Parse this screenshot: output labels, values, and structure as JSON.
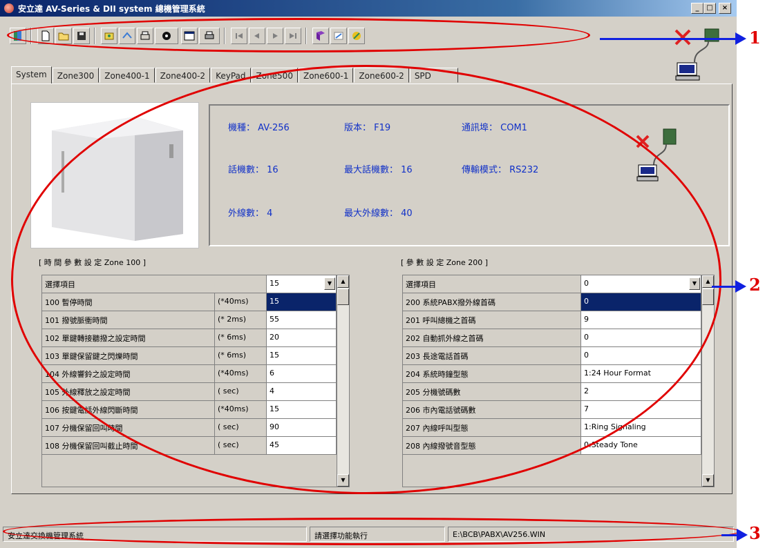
{
  "window": {
    "title": "安立達 AV-Series & DII system 總機管理系統",
    "min_label": "_",
    "max_label": "□",
    "close_label": "×"
  },
  "toolbar": {
    "icons": [
      "exit-icon",
      "new-file-icon",
      "open-folder-icon",
      "save-icon",
      "connect-icon",
      "transfer-icon",
      "print-setup-icon",
      "view-icon",
      "layout-icon",
      "print-icon",
      "first-record-icon",
      "prev-record-icon",
      "next-record-icon",
      "last-record-icon",
      "book-icon",
      "settings-icon",
      "wizard-icon"
    ]
  },
  "tabs": [
    "System",
    "Zone300",
    "Zone400-1",
    "Zone400-2",
    "KeyPad",
    "Zone500",
    "Zone600-1",
    "Zone600-2",
    "SPD"
  ],
  "info": {
    "model": "機種： AV-256",
    "version": "版本： F19",
    "comport": "通訊埠： COM1",
    "extensions": "話機數： 16",
    "max_extensions": "最大話機數： 16",
    "transfer_mode": "傳輸模式： RS232",
    "lines": "外線數： 4",
    "max_lines": "最大外線數： 40"
  },
  "left_section": {
    "title": "[  時 間 參 數 設 定   Zone 100 ]",
    "select_label": "選擇項目",
    "select_value": "15",
    "rows": [
      {
        "label": "100 暫停時間",
        "unit": "(*40ms)",
        "value": "15"
      },
      {
        "label": "101 撥號脈衝時間",
        "unit": "(* 2ms)",
        "value": "55"
      },
      {
        "label": "102 單鍵轉接聽撥之設定時間",
        "unit": "(* 6ms)",
        "value": "20"
      },
      {
        "label": "103 單鍵保留鍵之閃爍時間",
        "unit": "(* 6ms)",
        "value": "15"
      },
      {
        "label": "104 外線響鈴之設定時間",
        "unit": "(*40ms)",
        "value": "6"
      },
      {
        "label": "105 外線釋放之設定時間",
        "unit": "(  sec)",
        "value": "4"
      },
      {
        "label": "106 按鍵電話外線閃斷時間",
        "unit": "(*40ms)",
        "value": "15"
      },
      {
        "label": "107 分機保留回叫時間",
        "unit": "(  sec)",
        "value": "90"
      },
      {
        "label": "108 分機保留回叫截止時間",
        "unit": "(  sec)",
        "value": "45"
      }
    ]
  },
  "right_section": {
    "title": "[  參 數 設 定   Zone 200 ]",
    "select_label": "選擇項目",
    "select_value": "0",
    "rows": [
      {
        "label": "200 系統PABX撥外線首碼",
        "value": "0"
      },
      {
        "label": "201 呼叫總機之首碼",
        "value": "9"
      },
      {
        "label": "202 自動抓外線之首碼",
        "value": "0"
      },
      {
        "label": "203 長途電話首碼",
        "value": "0"
      },
      {
        "label": "204 系統時鐘型態",
        "value": "1:24 Hour Format"
      },
      {
        "label": "205 分機號碼數",
        "value": "2"
      },
      {
        "label": "206 市內電話號碼數",
        "value": "7"
      },
      {
        "label": "207 內線呼叫型態",
        "value": "1:Ring Signaling"
      },
      {
        "label": "208 內線撥號音型態",
        "value": "0:Steady Tone"
      }
    ]
  },
  "statusbar": {
    "app": "安立達交換機管理系統",
    "hint": "請選擇功能執行",
    "path": "E:\\BCB\\PABX\\AV256.WIN"
  },
  "annotations": [
    "1",
    "2",
    "3"
  ]
}
